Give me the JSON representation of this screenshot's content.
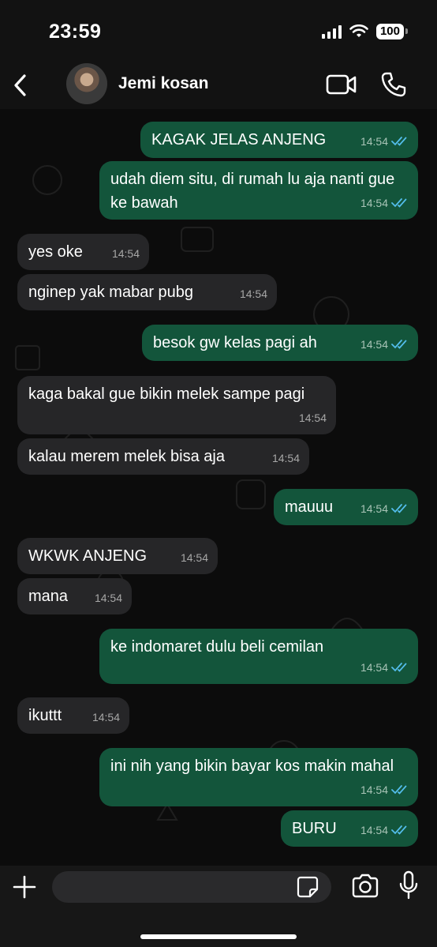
{
  "status_bar": {
    "time": "23:59",
    "battery": "100"
  },
  "header": {
    "contact_name": "Jemi kosan"
  },
  "messages": [
    {
      "dir": "out",
      "text": "KAGAK JELAS ANJENG",
      "time": "14:54"
    },
    {
      "dir": "out",
      "text": "udah diem situ, di rumah lu aja nanti gue ke bawah",
      "time": "14:54"
    },
    {
      "dir": "in",
      "text": "yes oke",
      "time": "14:54"
    },
    {
      "dir": "in",
      "text": "nginep yak mabar pubg",
      "time": "14:54"
    },
    {
      "dir": "out",
      "text": "besok gw kelas pagi ah",
      "time": "14:54"
    },
    {
      "dir": "in",
      "text": "kaga bakal gue bikin melek sampe pagi",
      "time": "14:54"
    },
    {
      "dir": "in",
      "text": "kalau merem melek bisa aja",
      "time": "14:54"
    },
    {
      "dir": "out",
      "text": "mauuu",
      "time": "14:54"
    },
    {
      "dir": "in",
      "text": "WKWK ANJENG",
      "time": "14:54"
    },
    {
      "dir": "in",
      "text": "mana",
      "time": "14:54"
    },
    {
      "dir": "out",
      "text": "ke indomaret dulu beli cemilan",
      "time": "14:54"
    },
    {
      "dir": "in",
      "text": "ikuttt",
      "time": "14:54"
    },
    {
      "dir": "out",
      "text": "ini nih yang bikin bayar kos makin mahal",
      "time": "14:54"
    },
    {
      "dir": "out",
      "text": "BURU",
      "time": "14:54"
    }
  ],
  "composer": {
    "placeholder": ""
  },
  "colors": {
    "incoming_bubble": "#262628",
    "outgoing_bubble": "#13553b",
    "read_tick": "#53bdeb"
  },
  "icons": [
    "back-chevron-icon",
    "video-call-icon",
    "phone-icon",
    "plus-icon",
    "sticker-icon",
    "camera-icon",
    "mic-icon",
    "double-check-icon"
  ]
}
